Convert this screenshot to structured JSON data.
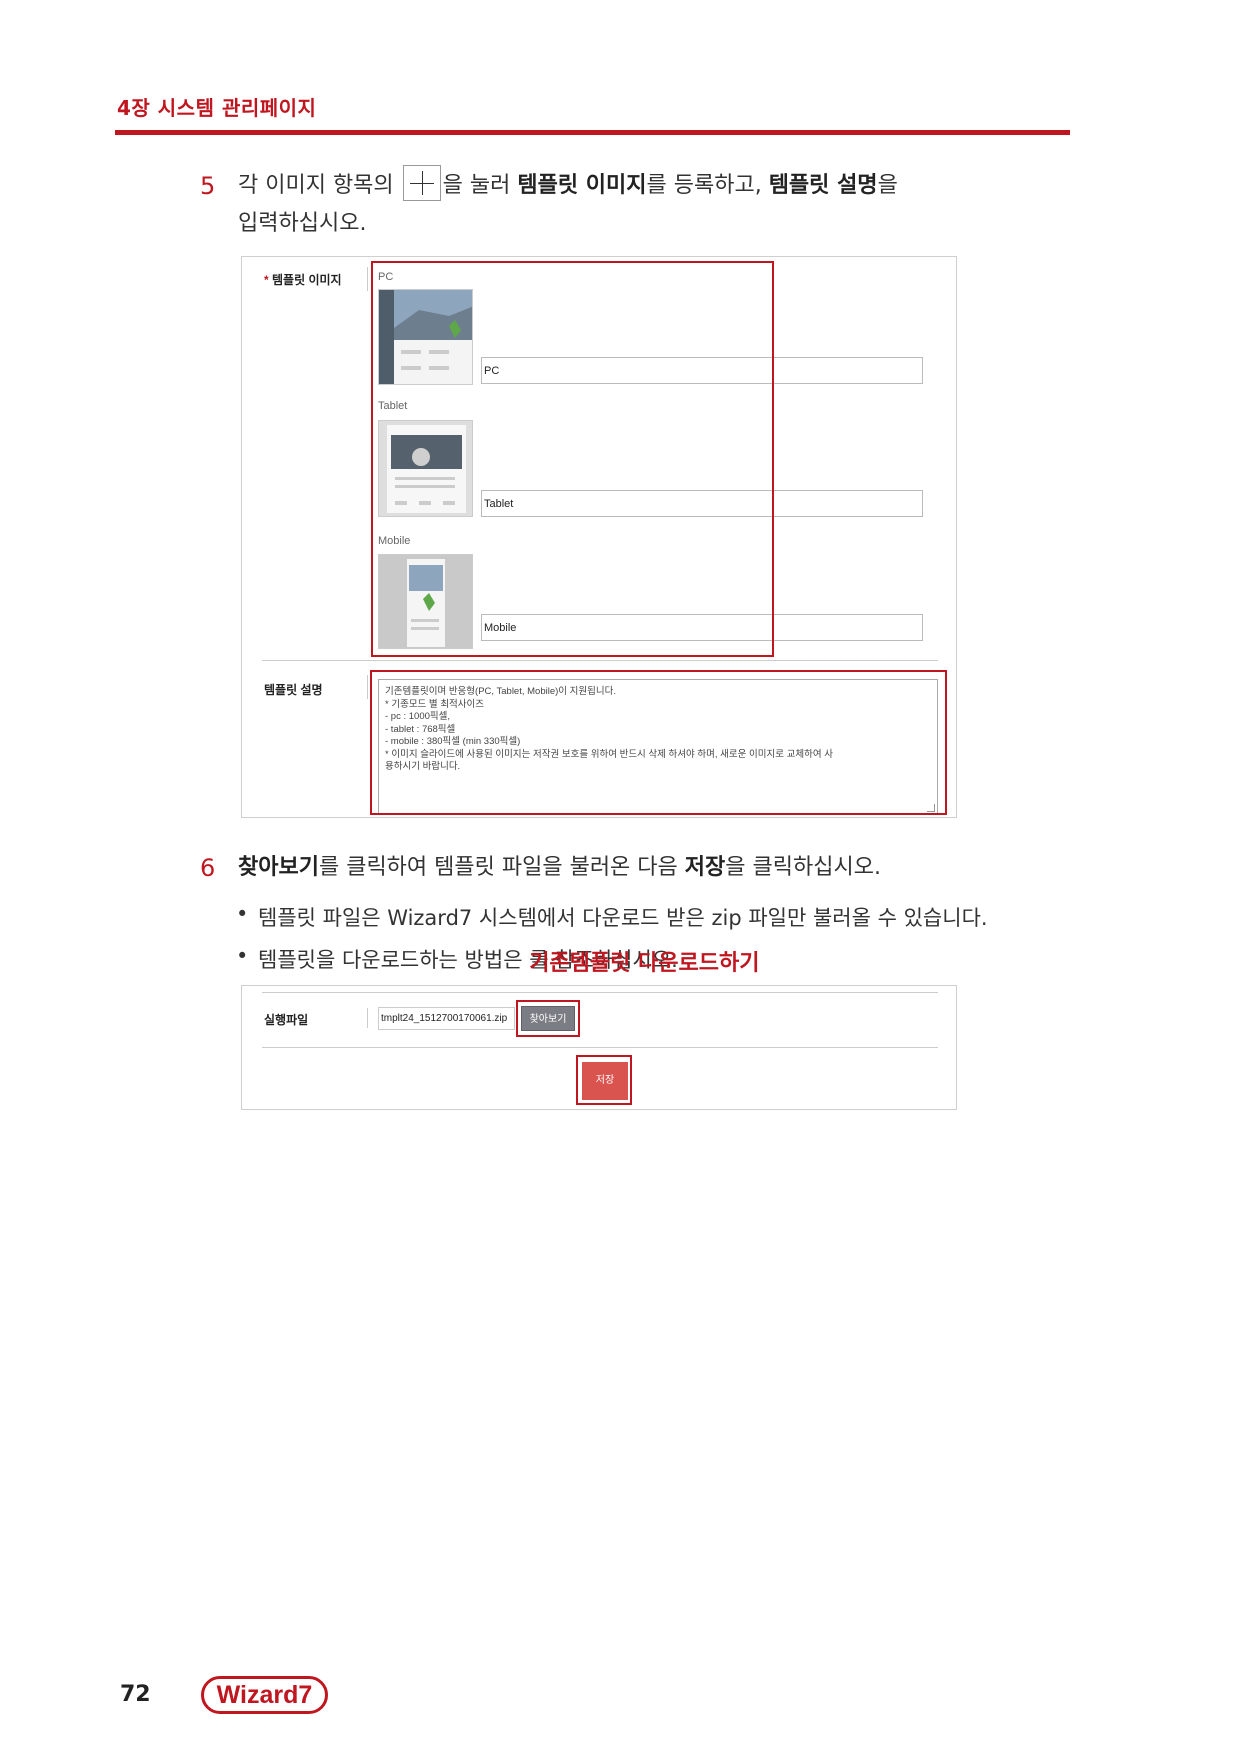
{
  "header": {
    "chapter": "4장 시스템 관리페이지"
  },
  "step5": {
    "number": "5",
    "line1_a": "각 이미지 항목의 ",
    "line1_b": "을 눌러 ",
    "bold1": "템플릿 이미지",
    "line1_c": "를 등록하고, ",
    "bold2": "템플릿 설명",
    "line1_d": "을",
    "line2": "입력하십시오."
  },
  "screenshot1": {
    "image_label_star": "*",
    "image_label": "템플릿 이미지",
    "devices": [
      {
        "label": "PC",
        "input_value": "PC"
      },
      {
        "label": "Tablet",
        "input_value": "Tablet"
      },
      {
        "label": "Mobile",
        "input_value": "Mobile"
      }
    ],
    "desc_label": "템플릿 설명",
    "desc_lines": [
      "기존템플릿이며 반응형(PC, Tablet, Mobile)이 지원됩니다.",
      "* 기종모드 별 최적사이즈",
      "- pc : 1000픽셀,",
      "- tablet : 768픽셀",
      "- mobile : 380픽셀 (min 330픽셀)",
      "* 이미지 슬라이드에 사용된 이미지는 저작권 보호를 위하여 반드시 삭제 하셔야 하며, 새로운 이미지로 교체하여 사",
      "용하시기 바랍니다."
    ]
  },
  "step6": {
    "number": "6",
    "bold1": "찾아보기",
    "text_a": "를 클릭하여 템플릿 파일을 불러온 다음 ",
    "bold2": "저장",
    "text_b": "을 클릭하십시오."
  },
  "bullets": {
    "b1": "템플릿 파일은 Wizard7 시스템에서 다운로드 받은 zip 파일만 불러올 수 있습니다.",
    "b2_a": "템플릿을 다운로드하는 방법은 ",
    "b2_red": "기존템플릿 다운로드하기",
    "b2_b": "를 참조하십시오."
  },
  "screenshot2": {
    "file_label": "실행파일",
    "file_value": "tmplt24_1512700170061.zip",
    "browse_label": "찾아보기",
    "save_label": "저장"
  },
  "footer": {
    "page_number": "72",
    "logo": "Wizard7"
  },
  "colors": {
    "accent": "#c0161f",
    "save_button": "#d9534f",
    "browse_button": "#7a7d83"
  },
  "icons": {
    "plus_button": "plus-icon"
  }
}
